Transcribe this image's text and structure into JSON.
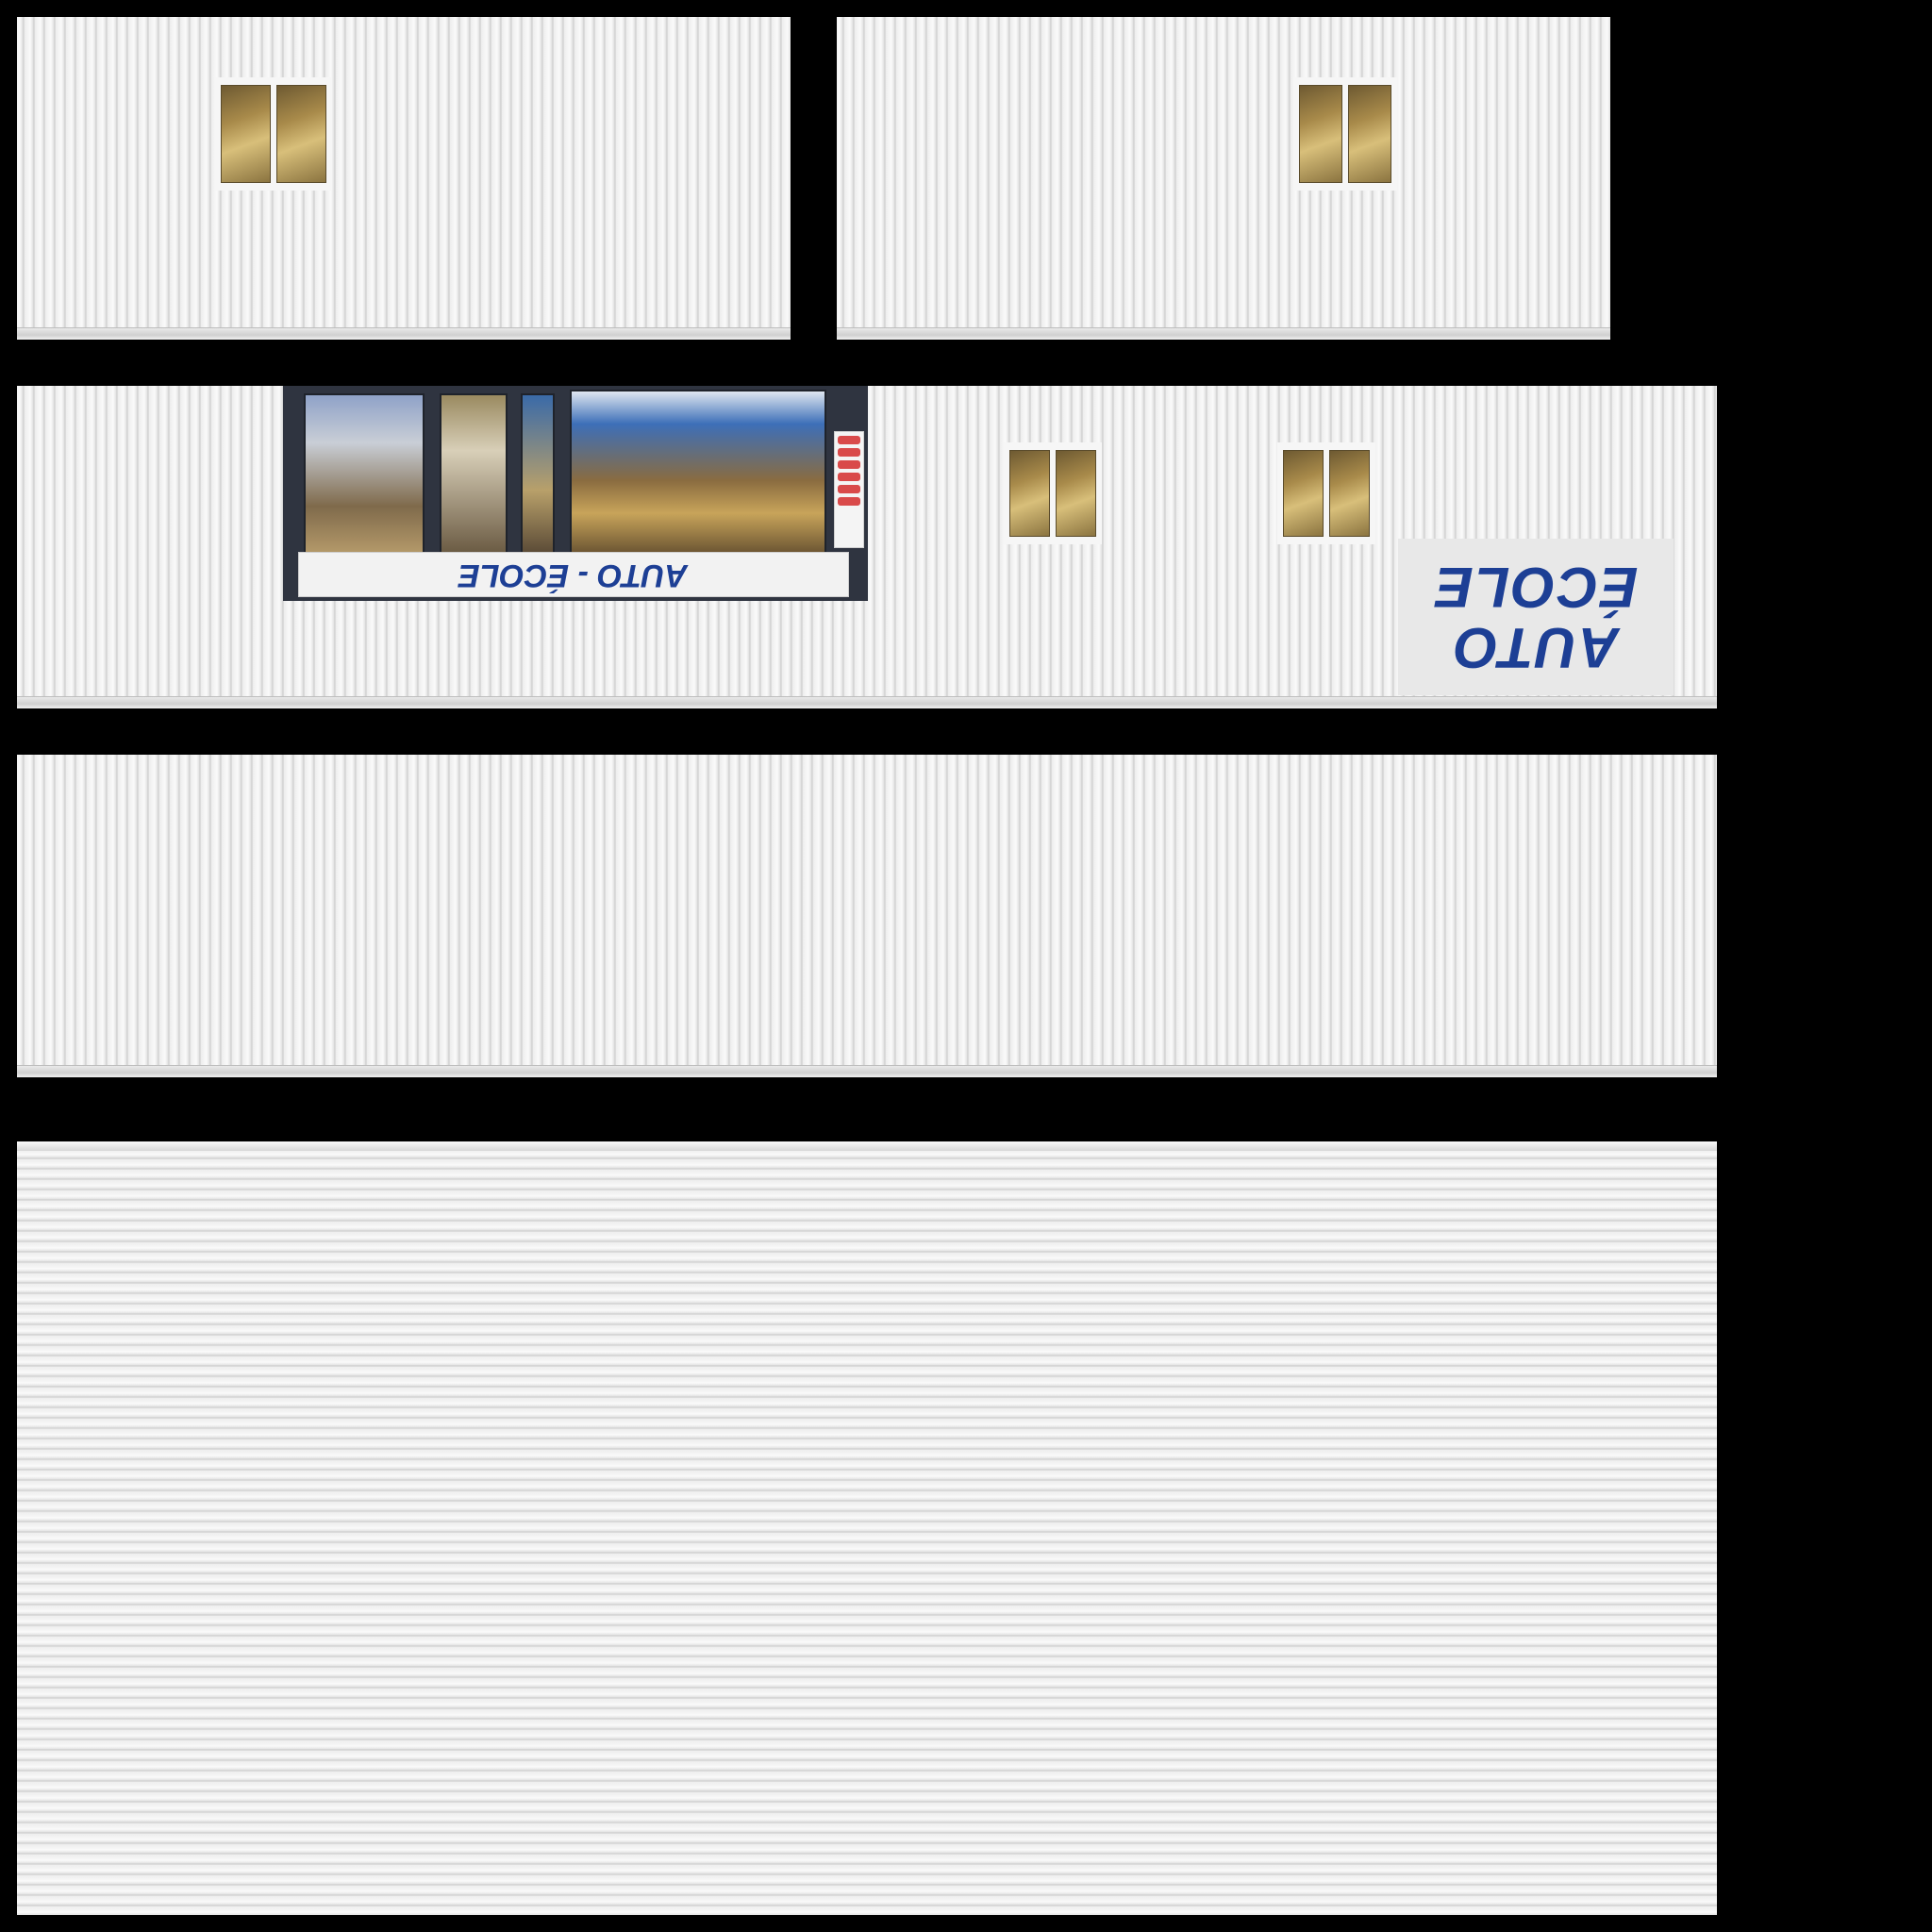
{
  "storefront_sign": {
    "text": "AUTO - ÉCOLE"
  },
  "side_sign": {
    "line1": "AUTO",
    "line2": "ÉCOLE"
  },
  "colors": {
    "background": "#000000",
    "cladding": "#f2f2f2",
    "sign_text": "#1d3f95",
    "window_glass": "#c9ad62",
    "storefront_frame": "#2f3440"
  }
}
